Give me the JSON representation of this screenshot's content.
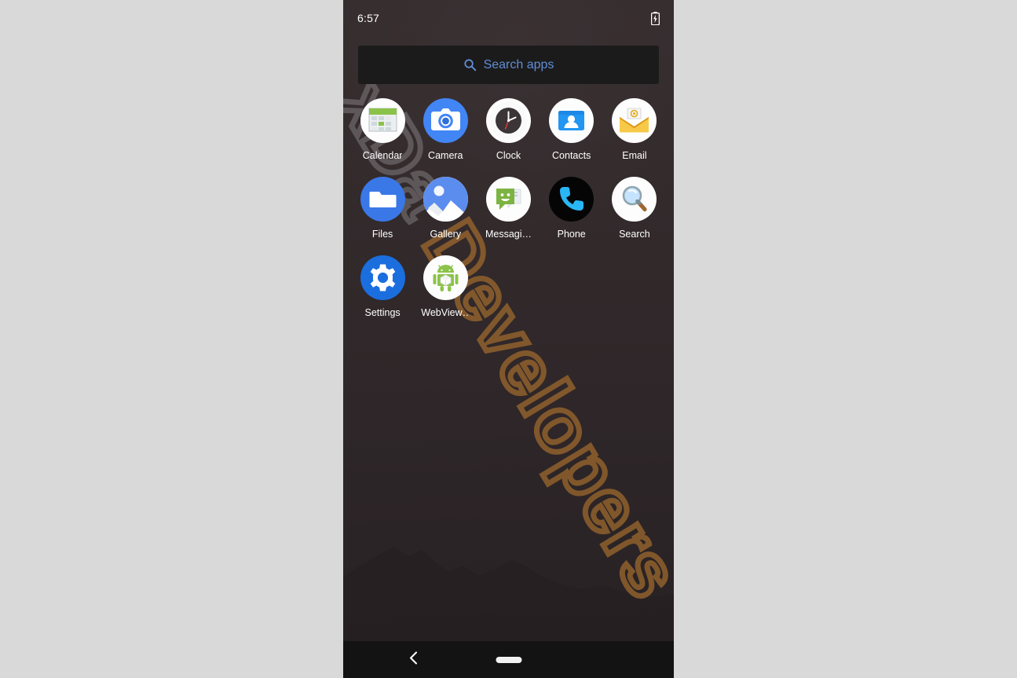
{
  "device": {
    "statusbar": {
      "time": "6:57",
      "battery_icon": "battery-charging-icon"
    },
    "search": {
      "icon": "search-icon",
      "placeholder": "Search apps",
      "value": ""
    },
    "apps": [
      {
        "label": "Calendar",
        "icon": "calendar-icon",
        "bg": "#fdfdfd"
      },
      {
        "label": "Camera",
        "icon": "camera-icon",
        "bg": "#4285f4"
      },
      {
        "label": "Clock",
        "icon": "clock-icon",
        "bg": "#fdfdfd"
      },
      {
        "label": "Contacts",
        "icon": "contacts-icon",
        "bg": "#fdfdfd"
      },
      {
        "label": "Email",
        "icon": "email-icon",
        "bg": "#fdfdfd"
      },
      {
        "label": "Files",
        "icon": "files-icon",
        "bg": "#3b78e7"
      },
      {
        "label": "Gallery",
        "icon": "gallery-icon",
        "bg": "#fdfdfd"
      },
      {
        "label": "Messagi…",
        "icon": "messaging-icon",
        "bg": "#fdfdfd"
      },
      {
        "label": "Phone",
        "icon": "phone-icon",
        "bg": "#050505"
      },
      {
        "label": "Search",
        "icon": "search-app-icon",
        "bg": "#fdfdfd"
      },
      {
        "label": "Settings",
        "icon": "settings-icon",
        "bg": "#1b6ede"
      },
      {
        "label": "WebView…",
        "icon": "webview-icon",
        "bg": "#fdfdfd"
      }
    ],
    "navbar": {
      "back": "back-icon",
      "home": "home-handle"
    },
    "watermark": {
      "prefix": "xDa ",
      "suffix": "Developers"
    },
    "colors": {
      "page_background": "#d9d9d9",
      "wallpaper_top": "#352c2e",
      "wallpaper_bottom": "#272123",
      "search_bar_bg": "#1c1b1c",
      "accent_blue": "#5f8ed4",
      "label_text": "#ffffff",
      "navbar_bg": "#131314",
      "watermark_gray": "#96949 6",
      "watermark_brown": "#96642d"
    }
  }
}
